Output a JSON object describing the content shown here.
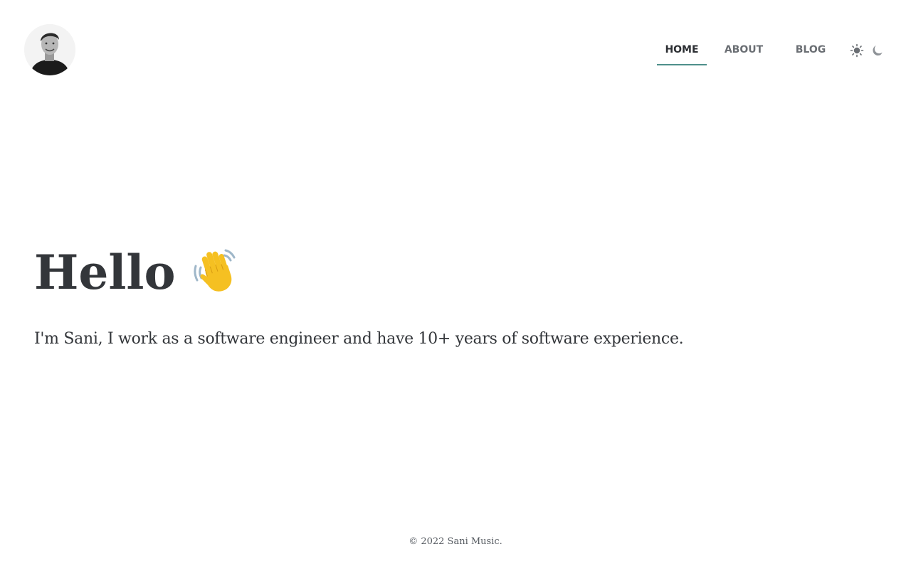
{
  "header": {
    "avatar_icon": "profile-photo",
    "nav": [
      {
        "label": "HOME",
        "active": true
      },
      {
        "label": "ABOUT",
        "active": false
      },
      {
        "label": "BLOG",
        "active": false
      }
    ],
    "theme_icons": [
      "sun-icon",
      "moon-icon"
    ]
  },
  "hero": {
    "title": "Hello",
    "title_emoji_icon": "waving-hand-icon",
    "intro": "I'm Sani, I work as a software engineer and have 10+ years of software experience."
  },
  "footer": {
    "copyright": "© 2022 Sani Music."
  },
  "colors": {
    "accent": "#4e8f8b",
    "text": "#33363a",
    "nav_text": "#6a6e73",
    "background": "#ffffff"
  }
}
